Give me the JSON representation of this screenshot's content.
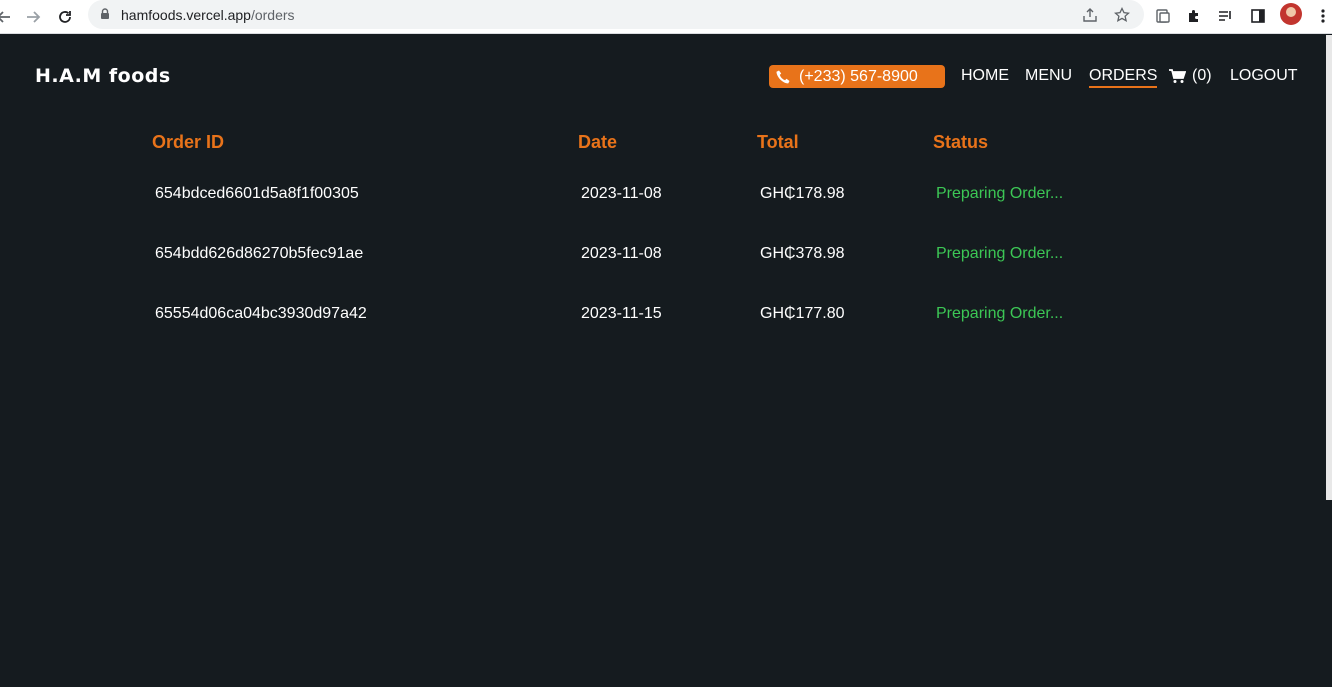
{
  "browser": {
    "url_host": "hamfoods.vercel.app",
    "url_path": "/orders"
  },
  "header": {
    "brand": "H.A.M foods",
    "phone": "(+233) 567-8900",
    "nav": {
      "home": "HOME",
      "menu": "MENU",
      "orders": "ORDERS",
      "cart_count": "(0)",
      "logout": "LOGOUT"
    }
  },
  "colors": {
    "accent": "#e8731a",
    "status_green": "#3cc755",
    "background": "#151b1f"
  },
  "orders_table": {
    "headers": {
      "id": "Order ID",
      "date": "Date",
      "total": "Total",
      "status": "Status"
    },
    "rows": [
      {
        "id": "654bdced6601d5a8f1f00305",
        "date": "2023-11-08",
        "total": "GH₵178.98",
        "status": "Preparing Order..."
      },
      {
        "id": "654bdd626d86270b5fec91ae",
        "date": "2023-11-08",
        "total": "GH₵378.98",
        "status": "Preparing Order..."
      },
      {
        "id": "65554d06ca04bc3930d97a42",
        "date": "2023-11-15",
        "total": "GH₵177.80",
        "status": "Preparing Order..."
      }
    ]
  }
}
